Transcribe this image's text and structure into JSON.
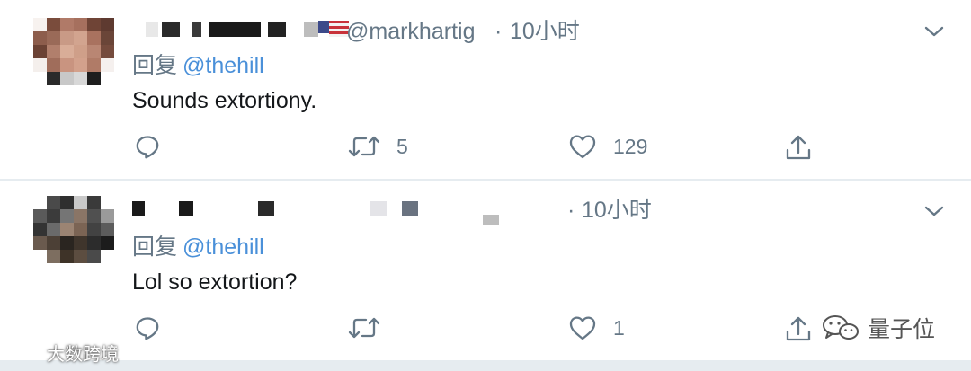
{
  "tweets": [
    {
      "handle": "@markhartig",
      "separator": "·",
      "time": "10小时",
      "reply_prefix": "回复",
      "reply_mention": "@thehill",
      "text": "Sounds extortiony.",
      "retweet_count": "5",
      "like_count": "129"
    },
    {
      "handle": "",
      "separator": "·",
      "time": "10小时",
      "reply_prefix": "回复",
      "reply_mention": "@thehill",
      "text": "Lol so extortion?",
      "retweet_count": "",
      "like_count": "1"
    }
  ],
  "watermarks": {
    "left": "大数跨境",
    "right": "量子位"
  },
  "icons": [
    "reply-icon",
    "retweet-icon",
    "like-icon",
    "share-icon",
    "chevron-down-icon",
    "avatar-pixelated",
    "redacted-name"
  ],
  "colors": {
    "text_primary": "#14171a",
    "text_secondary": "#657786",
    "mention": "#4a90d9",
    "divider": "#e6ecf0"
  }
}
